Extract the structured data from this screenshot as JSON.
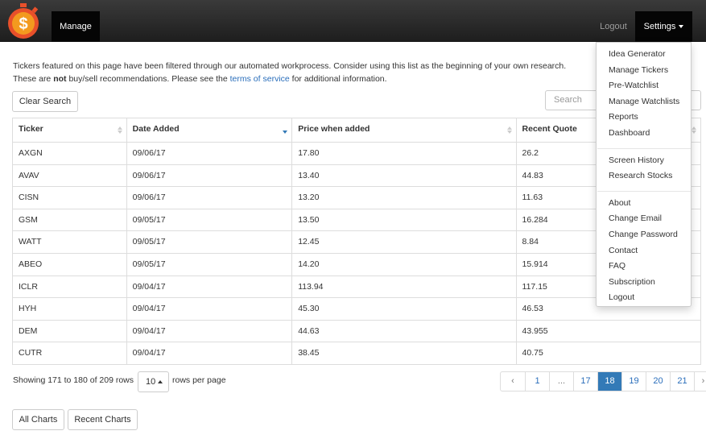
{
  "nav": {
    "manage_label": "Manage",
    "logout_label": "Logout",
    "settings_label": "Settings",
    "logo_icon": "dollar-stopwatch-icon"
  },
  "intro": {
    "line1": "Tickers featured on this page have been filtered through our automated workprocess. Consider using this list as the beginning of your own research.",
    "line2_before": "These are ",
    "line2_bold": "not",
    "line2_mid": " buy/sell recommendations. Please see the ",
    "line2_link": "terms of service",
    "line2_after": " for additional information."
  },
  "toolbar": {
    "clear_search_label": "Clear Search",
    "search_placeholder": "Search"
  },
  "table": {
    "headers": [
      "Ticker",
      "Date Added",
      "Price when added",
      "Recent Quote"
    ],
    "rows": [
      [
        "AXGN",
        "09/06/17",
        "17.80",
        "26.2"
      ],
      [
        "AVAV",
        "09/06/17",
        "13.40",
        "44.83"
      ],
      [
        "CISN",
        "09/06/17",
        "13.20",
        "11.63"
      ],
      [
        "GSM",
        "09/05/17",
        "13.50",
        "16.284"
      ],
      [
        "WATT",
        "09/05/17",
        "12.45",
        "8.84"
      ],
      [
        "ABEO",
        "09/05/17",
        "14.20",
        "15.914"
      ],
      [
        "ICLR",
        "09/04/17",
        "113.94",
        "117.15"
      ],
      [
        "HYH",
        "09/04/17",
        "45.30",
        "46.53"
      ],
      [
        "DEM",
        "09/04/17",
        "44.63",
        "43.955"
      ],
      [
        "CUTR",
        "09/04/17",
        "38.45",
        "40.75"
      ]
    ]
  },
  "footer": {
    "showing_text": "Showing 171 to 180 of 209 rows",
    "page_size": "10",
    "rows_per_page": "rows per page"
  },
  "pagination": {
    "items": [
      "‹",
      "1",
      "...",
      "17",
      "18",
      "19",
      "20",
      "21",
      "›"
    ],
    "active": "18"
  },
  "buttons": {
    "all_charts": "All Charts",
    "recent_charts": "Recent Charts"
  },
  "settings_menu": {
    "group1": [
      "Idea Generator",
      "Manage Tickers",
      "Pre-Watchlist",
      "Manage Watchlists",
      "Reports",
      "Dashboard"
    ],
    "group2": [
      "Screen History",
      "Research Stocks"
    ],
    "group3": [
      "About",
      "Change Email",
      "Change Password",
      "Contact",
      "FAQ",
      "Subscription",
      "Logout"
    ]
  },
  "colors": {
    "navbar": "#222222",
    "link": "#2a6ebb",
    "active_page": "#337ab7",
    "sort_active": "#337ab7"
  }
}
